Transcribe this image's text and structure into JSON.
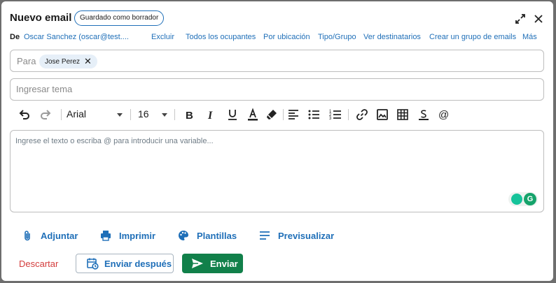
{
  "colors": {
    "accent": "#1f6fb8",
    "send": "#11804a",
    "danger": "#d33c3c"
  },
  "header": {
    "title": "Nuevo email",
    "badge": "Guardado como borrador",
    "icons": [
      "expand-icon",
      "close-icon"
    ]
  },
  "from_row": {
    "label": "De",
    "sender": "Oscar Sanchez (oscar@test....",
    "links": [
      "Excluir",
      "Todos los ocupantes",
      "Por ubicación",
      "Tipo/Grupo",
      "Ver destinatarios",
      "Crear un grupo de emails",
      "Más"
    ]
  },
  "to_field": {
    "placeholder": "Para",
    "chips": [
      {
        "label": "Jose Perez"
      }
    ]
  },
  "subject_field": {
    "placeholder": "Ingresar tema",
    "value": ""
  },
  "toolbar": {
    "font_family": "Arial",
    "font_size": "16",
    "tools": [
      "undo-icon",
      "redo-icon",
      "bold-icon",
      "italic-icon",
      "underline-icon",
      "font-color-icon",
      "highlight-icon",
      "align-left-icon",
      "bulleted-list-icon",
      "numbered-list-icon",
      "link-icon",
      "image-icon",
      "table-icon",
      "strikethrough-icon",
      "at-sign-icon"
    ]
  },
  "body_field": {
    "placeholder": "Ingrese el texto o escriba @ para introducir una variable..."
  },
  "actions": {
    "attach": "Adjuntar",
    "print": "Imprimir",
    "templates": "Plantillas",
    "preview": "Previsualizar"
  },
  "footer": {
    "discard": "Descartar",
    "send_later": "Enviar después",
    "send": "Enviar"
  }
}
